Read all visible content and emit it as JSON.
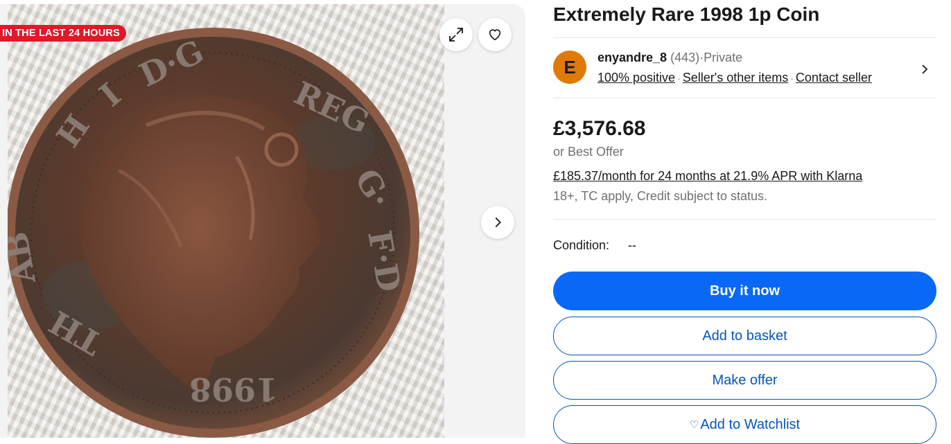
{
  "gallery": {
    "badge": "IN THE LAST 24 HOURS",
    "coin_image": {
      "description_icon": "coin-photo",
      "legend_text": "ELIZABETH II·D·G·REG·F·D·1998"
    },
    "icons": {
      "expand": "expand-icon",
      "watch": "heart-icon",
      "next": "chevron-right-icon"
    }
  },
  "listing": {
    "title": "Extremely Rare 1998 1p Coin",
    "seller": {
      "initial": "E",
      "name": "enyandre_8",
      "feedback_count": "(443)",
      "type": "Private",
      "positive": "100% positive",
      "other_items": "Seller's other items",
      "contact": "Contact seller",
      "separator": "·"
    },
    "price": "£3,576.68",
    "best_offer": "or Best Offer",
    "klarna": "£185.37/month for 24 months at 21.9% APR with Klarna",
    "terms": "18+, TC apply, Credit subject to status.",
    "condition_label": "Condition:",
    "condition_value": "--",
    "buttons": {
      "buy_now": "Buy it now",
      "add_basket": "Add to basket",
      "make_offer": "Make offer",
      "watchlist": "Add to Watchlist",
      "watchlist_icon": "♡"
    }
  },
  "colors": {
    "badge": "#e0182a",
    "primary_button": "#0968f6",
    "outline_button": "#0654ba",
    "avatar": "#e07a06"
  }
}
